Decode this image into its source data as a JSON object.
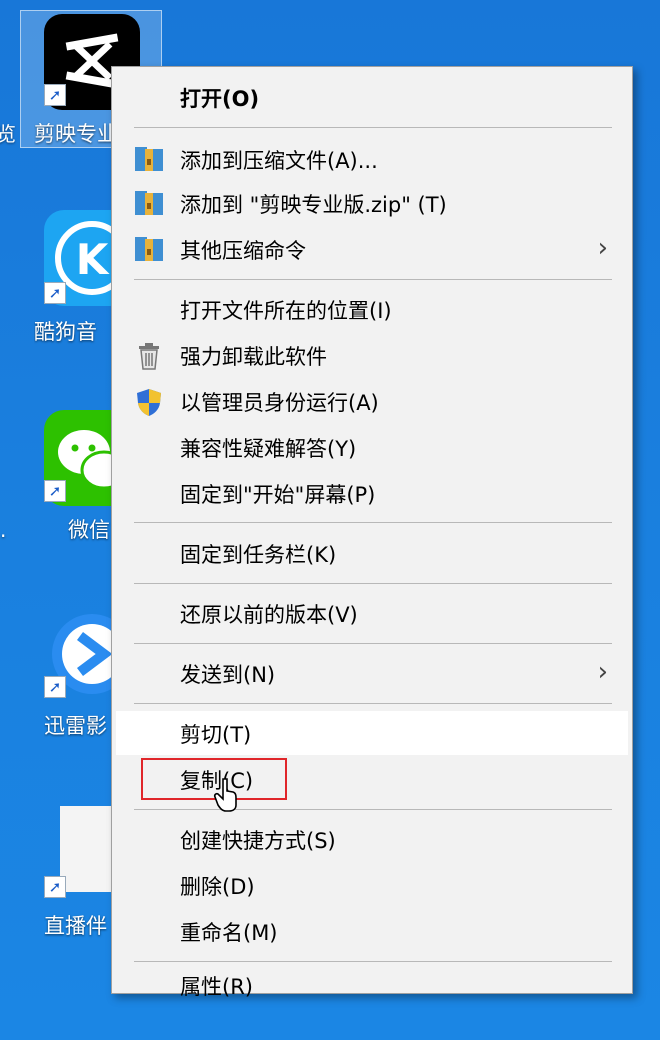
{
  "desktop": {
    "icons": [
      {
        "label": "剪映专业",
        "name": "jianying"
      },
      {
        "label": "酷狗音",
        "name": "kugou"
      },
      {
        "label": "微信",
        "name": "wechat"
      },
      {
        "label": "迅雷影",
        "name": "xunlei"
      },
      {
        "label": "直播伴",
        "name": "zhibo"
      }
    ],
    "left_edge_chars": [
      "览",
      "."
    ]
  },
  "menu": {
    "items": [
      {
        "label": "打开(O)"
      },
      {
        "label": "添加到压缩文件(A)..."
      },
      {
        "label": "添加到 \"剪映专业版.zip\" (T)"
      },
      {
        "label": "其他压缩命令"
      },
      {
        "label": "打开文件所在的位置(I)"
      },
      {
        "label": "强力卸载此软件"
      },
      {
        "label": "以管理员身份运行(A)"
      },
      {
        "label": "兼容性疑难解答(Y)"
      },
      {
        "label": "固定到\"开始\"屏幕(P)"
      },
      {
        "label": "固定到任务栏(K)"
      },
      {
        "label": "还原以前的版本(V)"
      },
      {
        "label": "发送到(N)"
      },
      {
        "label": "剪切(T)"
      },
      {
        "label": "复制(C)"
      },
      {
        "label": "创建快捷方式(S)"
      },
      {
        "label": "删除(D)"
      },
      {
        "label": "重命名(M)"
      },
      {
        "label": "属性(R)"
      }
    ],
    "submenu_arrow": "›"
  },
  "colors": {
    "desktop_bg": "#1a7fde",
    "menu_bg": "#f2f2f2",
    "highlight_border": "#e0262a"
  }
}
